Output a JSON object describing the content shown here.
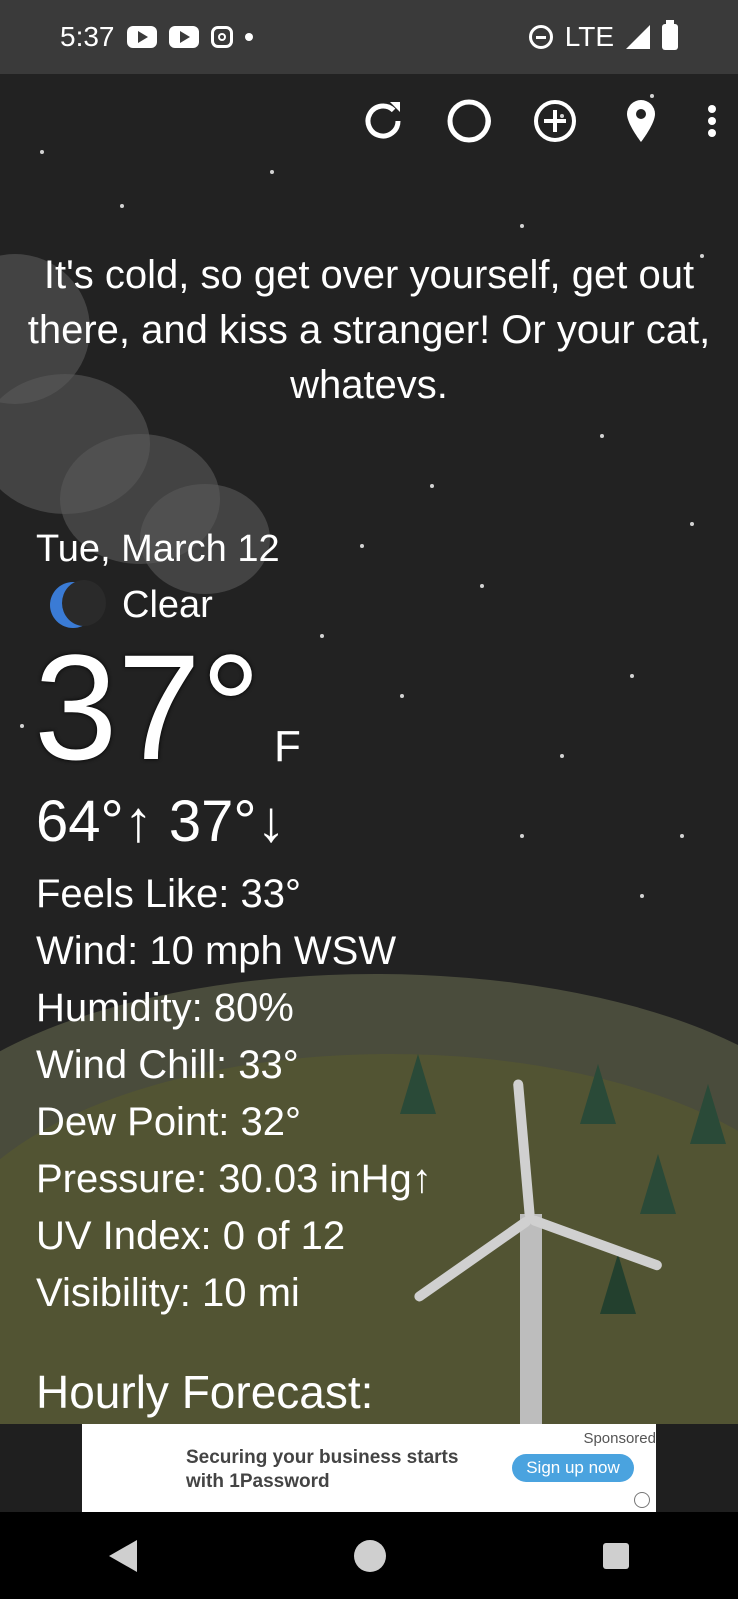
{
  "status": {
    "time": "5:37",
    "network": "LTE"
  },
  "top_actions": {
    "refresh": "refresh-icon",
    "theme": "moon-theme-icon",
    "add": "add-location-icon",
    "location": "location-pin-icon",
    "menu": "more-vert-icon"
  },
  "quote": "It's cold, so get over yourself, get out there, and kiss a stranger! Or your cat, whatevs.",
  "weather": {
    "date": "Tue, March 12",
    "condition": "Clear",
    "temperature": "37°",
    "unit": "F",
    "hi_lo": "64°↑ 37°↓"
  },
  "details": [
    "Feels Like:  33°",
    "Wind:  10 mph WSW",
    "Humidity:  80%",
    "Wind Chill:  33°",
    "Dew Point:  32°",
    "Pressure:  30.03 inHg↑",
    "UV Index:  0 of 12",
    "Visibility:  10 mi"
  ],
  "hourly_title": "Hourly Forecast:",
  "ad": {
    "text_line1": "Securing your business starts",
    "text_line2": "with 1Password",
    "sponsored": "Sponsored",
    "button": "Sign up now"
  }
}
